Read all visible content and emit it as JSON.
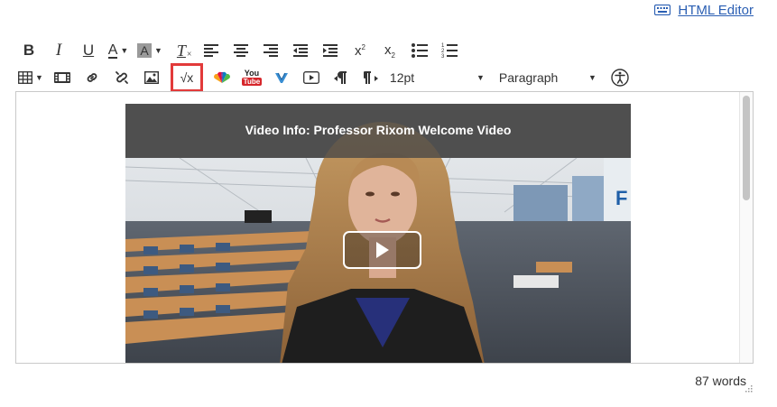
{
  "header": {
    "html_editor_label": "HTML Editor"
  },
  "toolbar": {
    "row1": {
      "bold": "B",
      "italic": "I",
      "underline": "U",
      "text_color": "A",
      "background_color": "A",
      "clear_format": "T",
      "superscript_base": "x",
      "subscript_base": "x"
    },
    "row2": {
      "youtube_top": "You",
      "youtube_bottom": "Tube",
      "math_equation": "√x",
      "font_size": "12pt",
      "format": "Paragraph"
    }
  },
  "video": {
    "title": "Video Info: Professor Rixom Welcome Video"
  },
  "status": {
    "word_count": "87 words"
  }
}
